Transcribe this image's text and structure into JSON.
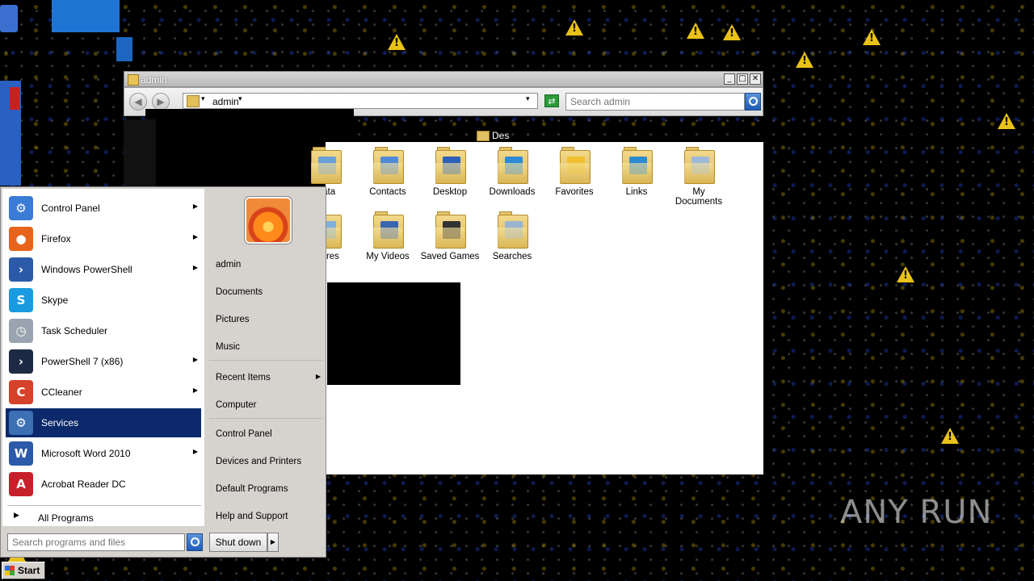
{
  "explorer": {
    "title": "admin",
    "nav": {
      "address_path": "admin",
      "search_placeholder": "Search admin"
    },
    "breadcrumb_fragment": "Des",
    "folders": [
      {
        "label": "Data",
        "icon": "appdata-folder-icon",
        "accent": "#6aa0d8"
      },
      {
        "label": "Contacts",
        "icon": "contacts-folder-icon",
        "accent": "#4f8ad6"
      },
      {
        "label": "Desktop",
        "icon": "desktop-folder-icon",
        "accent": "#2d5fb8"
      },
      {
        "label": "Downloads",
        "icon": "downloads-folder-icon",
        "accent": "#2e8ad8"
      },
      {
        "label": "Favorites",
        "icon": "favorites-folder-icon",
        "accent": "#f0c030"
      },
      {
        "label": "Links",
        "icon": "links-folder-icon",
        "accent": "#2b8bd0"
      },
      {
        "label": "My Documents",
        "icon": "documents-folder-icon",
        "accent": "#9eb8d8"
      },
      {
        "label": "ictures",
        "icon": "pictures-folder-icon",
        "accent": "#7fb0e0"
      },
      {
        "label": "My Videos",
        "icon": "videos-folder-icon",
        "accent": "#3a66b0"
      },
      {
        "label": "Saved Games",
        "icon": "saved-games-folder-icon",
        "accent": "#333333"
      },
      {
        "label": "Searches",
        "icon": "searches-folder-icon",
        "accent": "#9ab4d0"
      }
    ]
  },
  "start_menu": {
    "programs": [
      {
        "label": "Control Panel",
        "icon": "control-panel-icon",
        "color": "#3a7bd5",
        "glyph": "⚙",
        "has_submenu": true
      },
      {
        "label": "Firefox",
        "icon": "firefox-icon",
        "color": "#e8641b",
        "glyph": "●",
        "has_submenu": true
      },
      {
        "label": "Windows PowerShell",
        "icon": "powershell-icon",
        "color": "#2b5ba8",
        "glyph": "›",
        "has_submenu": true
      },
      {
        "label": "Skype",
        "icon": "skype-icon",
        "color": "#1a9be0",
        "glyph": "S",
        "has_submenu": false
      },
      {
        "label": "Task Scheduler",
        "icon": "task-scheduler-icon",
        "color": "#9aa4b0",
        "glyph": "◷",
        "has_submenu": false
      },
      {
        "label": "PowerShell 7 (x86)",
        "icon": "powershell7-icon",
        "color": "#1e2a44",
        "glyph": "›",
        "has_submenu": true
      },
      {
        "label": "CCleaner",
        "icon": "ccleaner-icon",
        "color": "#d6412a",
        "glyph": "C",
        "has_submenu": true
      },
      {
        "label": "Services",
        "icon": "services-gear-icon",
        "color": "#3c6fb4",
        "glyph": "⚙",
        "has_submenu": false
      },
      {
        "label": "Microsoft Word 2010",
        "icon": "word-icon",
        "color": "#2a5aa8",
        "glyph": "W",
        "has_submenu": true
      },
      {
        "label": "Acrobat Reader DC",
        "icon": "acrobat-icon",
        "color": "#c8202a",
        "glyph": "A",
        "has_submenu": false
      }
    ],
    "selected_index": 7,
    "all_programs_label": "All Programs",
    "right": {
      "user": "admin",
      "links": [
        "Documents",
        "Pictures",
        "Music",
        "Recent Items",
        "Computer",
        "Control Panel",
        "Devices and Printers",
        "Default Programs",
        "Help and Support"
      ]
    },
    "search_placeholder": "Search programs and files",
    "shutdown_label": "Shut down"
  },
  "taskbar": {
    "start_label": "Start"
  },
  "watermark": "ANY RUN"
}
